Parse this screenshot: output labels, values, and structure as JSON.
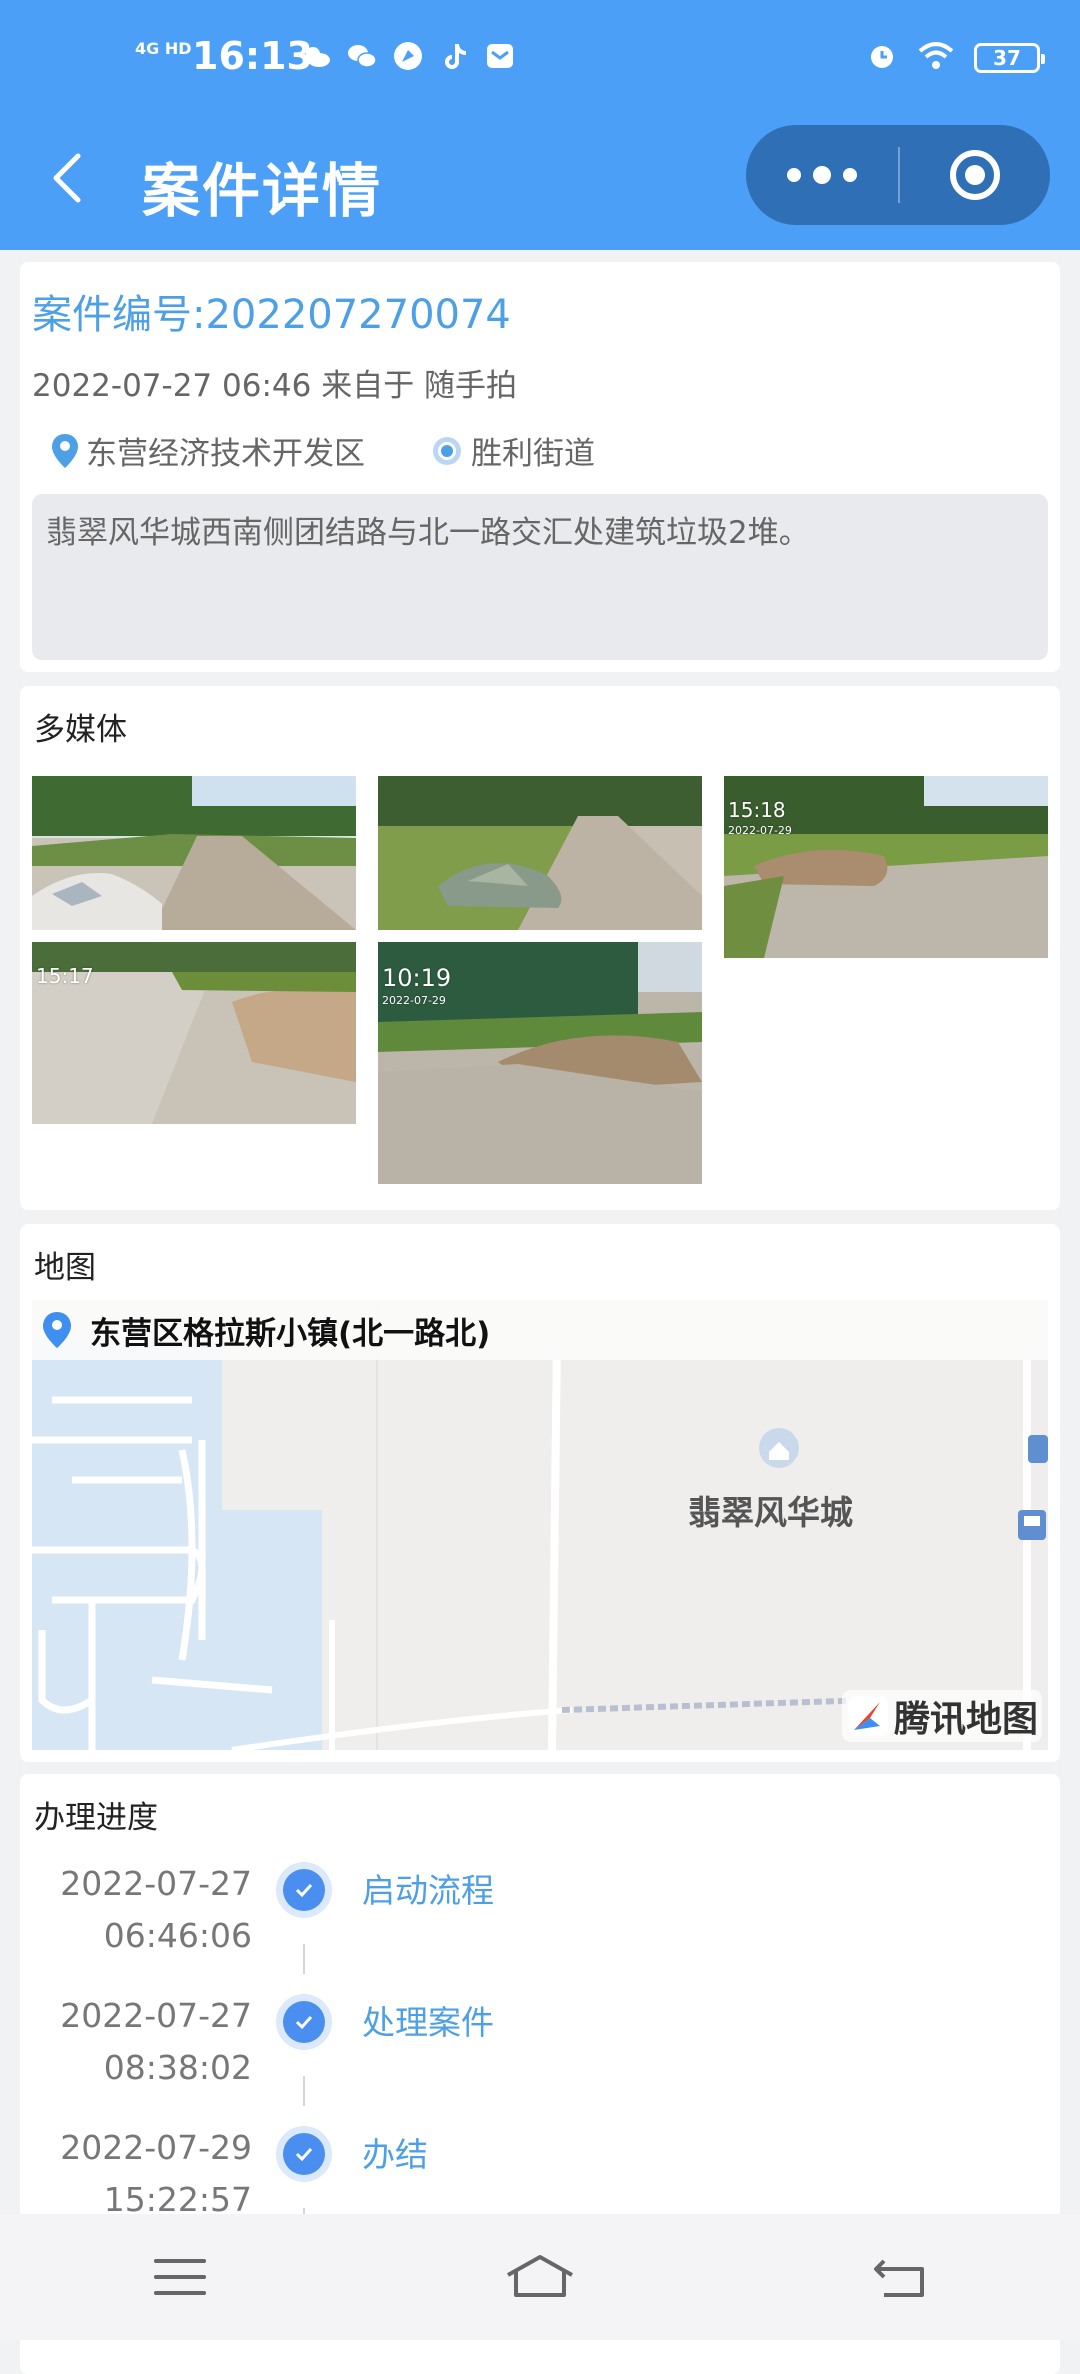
{
  "status_bar": {
    "network": "4G HD",
    "time": "16:13",
    "battery": "37",
    "app_icons": [
      "weather-icon",
      "wechat-icon",
      "compass-app-icon",
      "tiktok-icon",
      "message-icon"
    ]
  },
  "nav": {
    "title": "案件详情"
  },
  "case": {
    "number": "案件编号:202207270074",
    "meta": "2022-07-27 06:46 来自于 随手拍",
    "district": "东营经济技术开发区",
    "street": "胜利街道",
    "description": "翡翠风华城西南侧团结路与北一路交汇处建筑垃圾2堆。"
  },
  "media": {
    "title": "多媒体",
    "photos": [
      {
        "time": "",
        "date": ""
      },
      {
        "time": "",
        "date": ""
      },
      {
        "time": "15:18",
        "date": "2022-07-29"
      },
      {
        "time": "15:17",
        "date": ""
      },
      {
        "time": "10:19",
        "date": "2022-07-29"
      }
    ]
  },
  "map": {
    "title": "地图",
    "address": "东营区格拉斯小镇(北一路北)",
    "poi": "翡翠风华城",
    "provider": "腾讯地图"
  },
  "progress": {
    "title": "办理进度",
    "steps": [
      {
        "date": "2022-07-27",
        "time": "06:46:06",
        "label": "启动流程"
      },
      {
        "date": "2022-07-27",
        "time": "08:38:02",
        "label": "处理案件"
      },
      {
        "date": "2022-07-29",
        "time": "15:22:57",
        "label": "办结"
      }
    ]
  },
  "colors": {
    "primary": "#4c9ff6",
    "link": "#4d9fe6",
    "capsule": "#2e6fb5"
  }
}
